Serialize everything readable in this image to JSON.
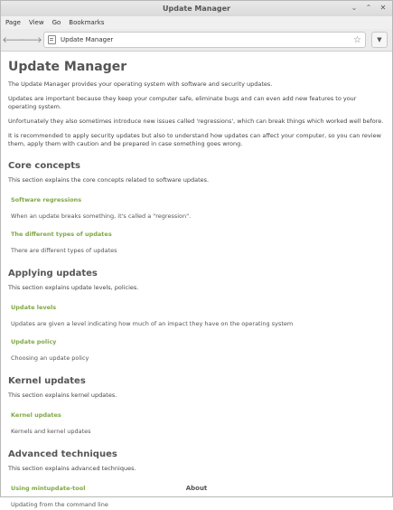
{
  "window": {
    "title": "Update Manager"
  },
  "menu": {
    "items": [
      "Page",
      "View",
      "Go",
      "Bookmarks"
    ]
  },
  "address": {
    "text": "Update Manager"
  },
  "page": {
    "title": "Update Manager",
    "intro": [
      "The Update Manager provides your operating system with software and security updates.",
      "Updates are important because they keep your computer safe, eliminate bugs and can even add new features to your operating system.",
      "Unfortunately they also sometimes introduce new issues called 'regressions', which can break things which worked well before.",
      "It is recommended to apply security updates but also to understand how updates can affect your computer, so you can review them, apply them with caution and be prepared in case something goes wrong."
    ],
    "sections": [
      {
        "heading": "Core concepts",
        "desc": "This section explains the core concepts related to software updates.",
        "links": [
          {
            "title": "Software regressions",
            "desc": "When an update breaks something, it's called a \"regression\"."
          },
          {
            "title": "The different types of updates",
            "desc": "There are different types of updates"
          }
        ]
      },
      {
        "heading": "Applying updates",
        "desc": "This section explains update levels, policies.",
        "links": [
          {
            "title": "Update levels",
            "desc": "Updates are given a level indicating how much of an impact they have on the operating system"
          },
          {
            "title": "Update policy",
            "desc": "Choosing an update policy"
          }
        ]
      },
      {
        "heading": "Kernel updates",
        "desc": "This section explains kernel updates.",
        "links": [
          {
            "title": "Kernel updates",
            "desc": "Kernels and kernel updates"
          }
        ]
      },
      {
        "heading": "Advanced techniques",
        "desc": "This section explains advanced techniques.",
        "links": [
          {
            "title": "Using mintupdate-tool",
            "desc": "Updating from the command line"
          }
        ]
      }
    ],
    "footer_link": "About"
  },
  "colors": {
    "link": "#7ea843",
    "heading": "#555555"
  }
}
